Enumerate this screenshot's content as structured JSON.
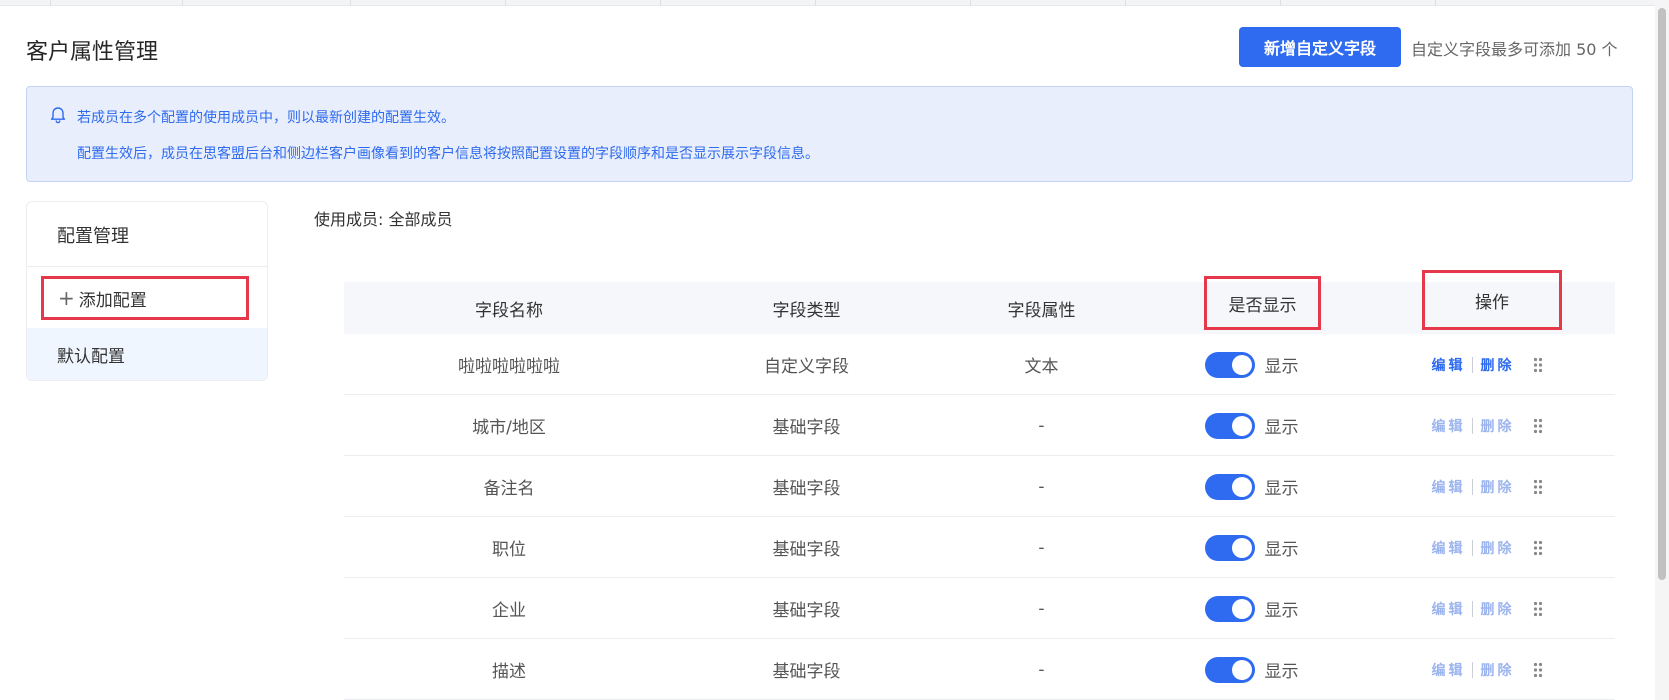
{
  "header": {
    "title": "客户属性管理",
    "add_field_label": "新增自定义字段",
    "add_field_hint": "自定义字段最多可添加 50 个"
  },
  "notice": {
    "icon": "bell-icon",
    "line1": "若成员在多个配置的使用成员中，则以最新创建的配置生效。",
    "line2": "配置生效后，成员在思客盟后台和侧边栏客户画像看到的客户信息将按照配置设置的字段顺序和是否显示展示字段信息。"
  },
  "config_panel": {
    "title": "配置管理",
    "add_label": "添加配置",
    "default_label": "默认配置"
  },
  "members": {
    "label": "使用成员:",
    "value": "全部成员"
  },
  "table": {
    "columns": [
      "字段名称",
      "字段类型",
      "字段属性",
      "是否显示",
      "操作"
    ],
    "rows": [
      {
        "name": "啦啦啦啦啦啦",
        "type": "自定义字段",
        "attr": "文本",
        "show": "显示",
        "edit": "编辑",
        "delete": "删除"
      },
      {
        "name": "城市/地区",
        "type": "基础字段",
        "attr": "-",
        "show": "显示",
        "edit": "编辑",
        "delete": "删除"
      },
      {
        "name": "备注名",
        "type": "基础字段",
        "attr": "-",
        "show": "显示",
        "edit": "编辑",
        "delete": "删除"
      },
      {
        "name": "职位",
        "type": "基础字段",
        "attr": "-",
        "show": "显示",
        "edit": "编辑",
        "delete": "删除"
      },
      {
        "name": "企业",
        "type": "基础字段",
        "attr": "-",
        "show": "显示",
        "edit": "编辑",
        "delete": "删除"
      },
      {
        "name": "描述",
        "type": "基础字段",
        "attr": "-",
        "show": "显示",
        "edit": "编辑",
        "delete": "删除"
      }
    ]
  },
  "colors": {
    "primary": "#2f6bf0",
    "notice_bg": "#e8eefb",
    "highlight_border": "#e5394b",
    "op_disabled": "#9db5ee"
  }
}
